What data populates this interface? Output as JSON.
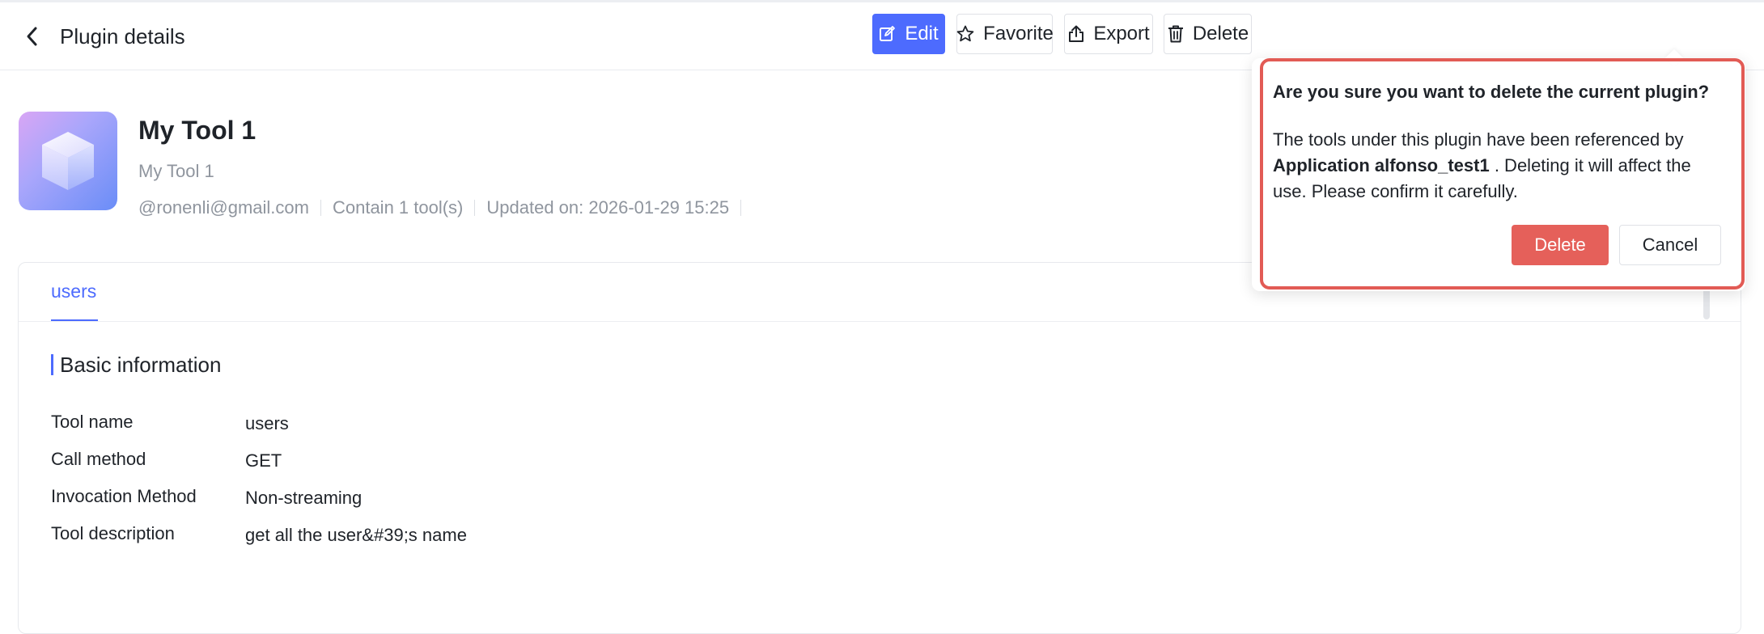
{
  "header": {
    "back_icon": "arrow-left-icon",
    "title": "Plugin details",
    "actions": {
      "edit": "Edit",
      "favorite": "Favorite",
      "export": "Export",
      "delete": "Delete"
    }
  },
  "plugin": {
    "name": "My Tool 1",
    "description": "My Tool 1",
    "author": "@ronenli@gmail.com",
    "tool_count": "Contain 1 tool(s)",
    "updated": "Updated on: 2026-01-29 15:25"
  },
  "tabs": [
    {
      "label": "users",
      "active": true
    }
  ],
  "basic_info": {
    "section_title": "Basic information",
    "rows": [
      {
        "key": "Tool name",
        "value": "users"
      },
      {
        "key": "Call method",
        "value": "GET"
      },
      {
        "key": "Invocation Method",
        "value": "Non-streaming"
      },
      {
        "key": "Tool description",
        "value": "get all the user&#39;s name"
      }
    ]
  },
  "confirm": {
    "title": "Are you sure you want to delete the current plugin?",
    "body_prefix": "The tools under this plugin have been referenced by ",
    "body_bold": "Application alfonso_test1",
    "body_suffix": " . Deleting it will affect the use. Please confirm it carefully.",
    "delete_label": "Delete",
    "cancel_label": "Cancel"
  },
  "colors": {
    "primary": "#4d6bfe",
    "danger": "#e5605a",
    "highlight_outline": "#e25b55"
  }
}
